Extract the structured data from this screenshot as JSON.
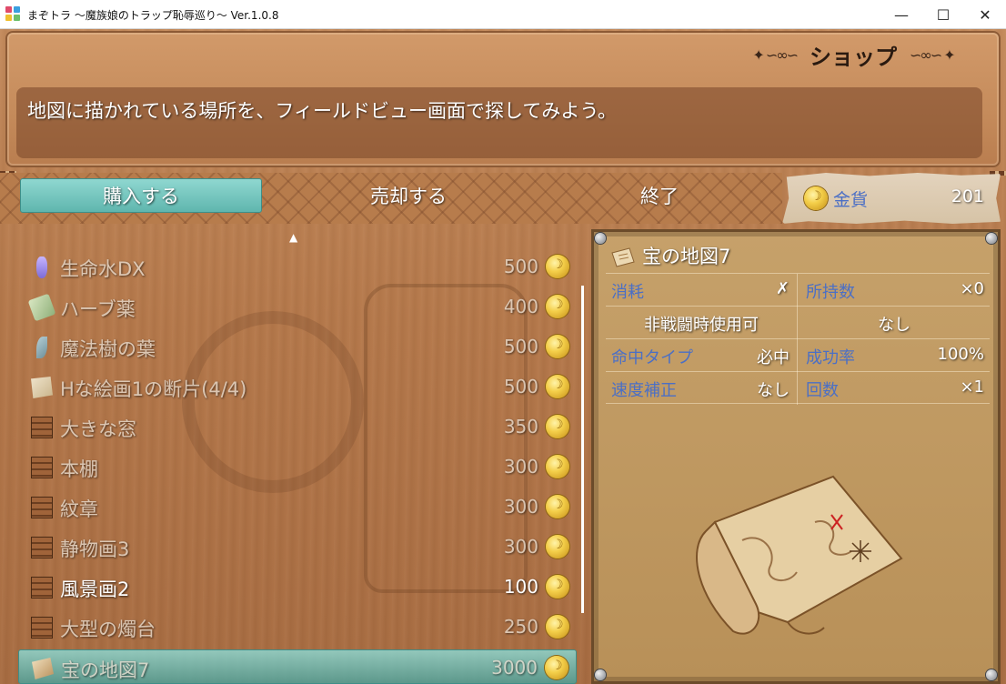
{
  "window": {
    "title": "まぞトラ ～魔族娘のトラップ恥辱巡り～ Ver.1.0.8",
    "minimize_glyph": "—",
    "maximize_glyph": "☐",
    "close_glyph": "✕"
  },
  "header": {
    "title": "ショップ",
    "help_text": "地図に描かれている場所を、フィールドビュー画面で探してみよう。"
  },
  "commands": {
    "buy": "購入する",
    "sell": "売却する",
    "exit": "終了",
    "selected": "buy"
  },
  "gold": {
    "label": "金貨",
    "amount": "201"
  },
  "items": [
    {
      "name": "生命水DX",
      "price": "500",
      "icon": "potion-bottle-icon",
      "affordable": false
    },
    {
      "name": "ハーブ薬",
      "price": "400",
      "icon": "herb-icon",
      "affordable": false
    },
    {
      "name": "魔法樹の葉",
      "price": "500",
      "icon": "leaf-icon",
      "affordable": false
    },
    {
      "name": "Hな絵画1の断片(4/4)",
      "price": "500",
      "icon": "paper-fragment-icon",
      "affordable": false
    },
    {
      "name": "大きな窓",
      "price": "350",
      "icon": "furniture-icon",
      "affordable": false
    },
    {
      "name": "本棚",
      "price": "300",
      "icon": "furniture-icon",
      "affordable": false
    },
    {
      "name": "紋章",
      "price": "300",
      "icon": "furniture-icon",
      "affordable": false
    },
    {
      "name": "静物画3",
      "price": "300",
      "icon": "furniture-icon",
      "affordable": false
    },
    {
      "name": "風景画2",
      "price": "100",
      "icon": "furniture-icon",
      "affordable": true
    },
    {
      "name": "大型の燭台",
      "price": "250",
      "icon": "furniture-icon",
      "affordable": false
    },
    {
      "name": "宝の地図7",
      "price": "3000",
      "icon": "map-icon",
      "affordable": false,
      "selected": true
    }
  ],
  "scroll_up_glyph": "▲",
  "detail": {
    "title": "宝の地図7",
    "rows": [
      {
        "label1": "消耗",
        "value1": "✗",
        "label2": "所持数",
        "value2": "×0"
      },
      {
        "center1": "非戦闘時使用可",
        "center2": "なし"
      },
      {
        "label1": "命中タイプ",
        "value1": "必中",
        "label2": "成功率",
        "value2": "100%"
      },
      {
        "label1": "速度補正",
        "value1": "なし",
        "label2": "回数",
        "value2": "×1"
      }
    ]
  },
  "colors": {
    "accent_teal": "#5fb6ae",
    "label_blue": "#4b6fc5",
    "wood": "#b5784a",
    "parchment": "#c6a16a"
  }
}
